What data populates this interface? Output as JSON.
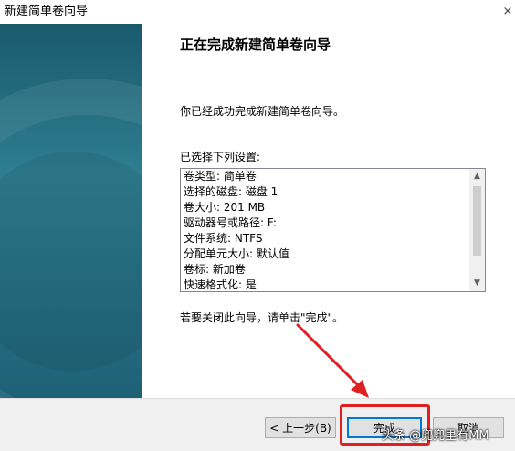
{
  "window": {
    "title": "新建简单卷向导",
    "close_glyph": "×"
  },
  "main": {
    "heading": "正在完成新建简单卷向导",
    "intro": "你已经成功完成新建简单卷向导。",
    "selected_label": "已选择下列设置:",
    "summary": [
      "卷类型: 简单卷",
      "选择的磁盘: 磁盘 1",
      "卷大小: 201 MB",
      "驱动器号或路径: F:",
      "文件系统: NTFS",
      "分配单元大小: 默认值",
      "卷标: 新加卷",
      "快速格式化: 是"
    ],
    "closing_hint": "若要关闭此向导，请单击\"完成\"。"
  },
  "footer": {
    "back_label": "< 上一步(B)",
    "finish_label": "完成",
    "cancel_label": "取消"
  },
  "overlay": {
    "watermark": "头条 @兜兜里有MM",
    "annotation_color": "#e02020"
  }
}
